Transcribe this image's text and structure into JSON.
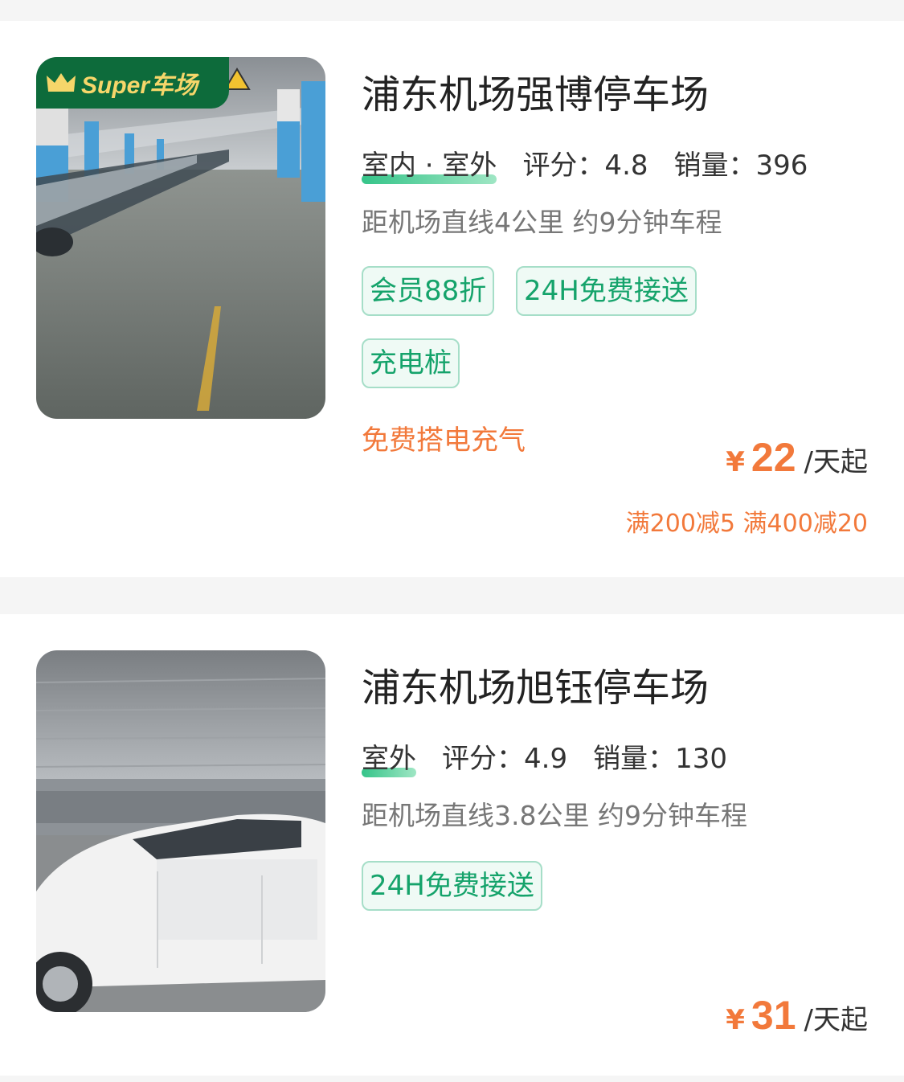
{
  "lots": [
    {
      "badge": "Super车场",
      "name": "浦东机场强博停车场",
      "type": "室内 · 室外",
      "rating_label": "评分：4.8",
      "sales_label": "销量：396",
      "distance": "距机场直线4公里 约9分钟车程",
      "tags": [
        "会员88折",
        "24H免费接送",
        "充电桩"
      ],
      "service": "免费搭电充气",
      "currency": "¥",
      "price": "22",
      "price_unit": "/天起",
      "promo": "满200减5 满400减20"
    },
    {
      "name": "浦东机场旭钰停车场",
      "type": "室外",
      "rating_label": "评分：4.9",
      "sales_label": "销量：130",
      "distance": "距机场直线3.8公里 约9分钟车程",
      "tags": [
        "24H免费接送"
      ],
      "currency": "¥",
      "price": "31",
      "price_unit": "/天起"
    }
  ],
  "colors": {
    "accent_green": "#15a36b",
    "accent_orange": "#f2793b",
    "badge_green": "#0d6b3b",
    "badge_gold": "#f6d66a"
  },
  "icons": [
    "crown-icon"
  ]
}
